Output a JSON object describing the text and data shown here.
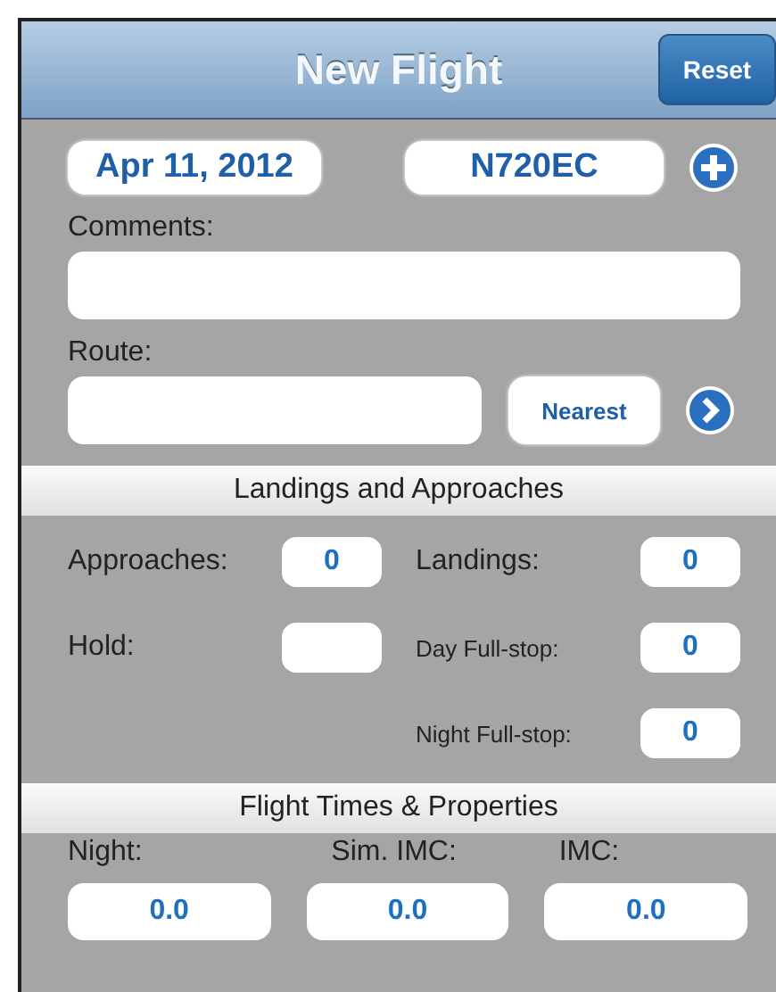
{
  "nav_bar": {
    "title": "New Flight",
    "reset_button": "Reset"
  },
  "header": {
    "date": "Apr 11, 2012",
    "aircraft": "N720EC"
  },
  "comments": {
    "label": "Comments:"
  },
  "route": {
    "label": "Route:",
    "nearest_button": "Nearest"
  },
  "landings_section": {
    "title": "Landings and Approaches",
    "left_fields": [
      {
        "label": "Approaches:",
        "value": "0"
      },
      {
        "label": "Hold:"
      }
    ],
    "right_fields": [
      {
        "label": "Landings:",
        "value": "0"
      },
      {
        "label": "Day Full-stop:",
        "value": "0"
      },
      {
        "label": "Night Full-stop:",
        "value": "0"
      }
    ]
  },
  "times_section": {
    "title": "Flight Times & Properties",
    "fields": [
      {
        "label": "Night:",
        "value": "0.0"
      },
      {
        "label": "Sim. IMC:",
        "value": "0.0"
      },
      {
        "label": "IMC:",
        "value": "0.0"
      }
    ]
  }
}
